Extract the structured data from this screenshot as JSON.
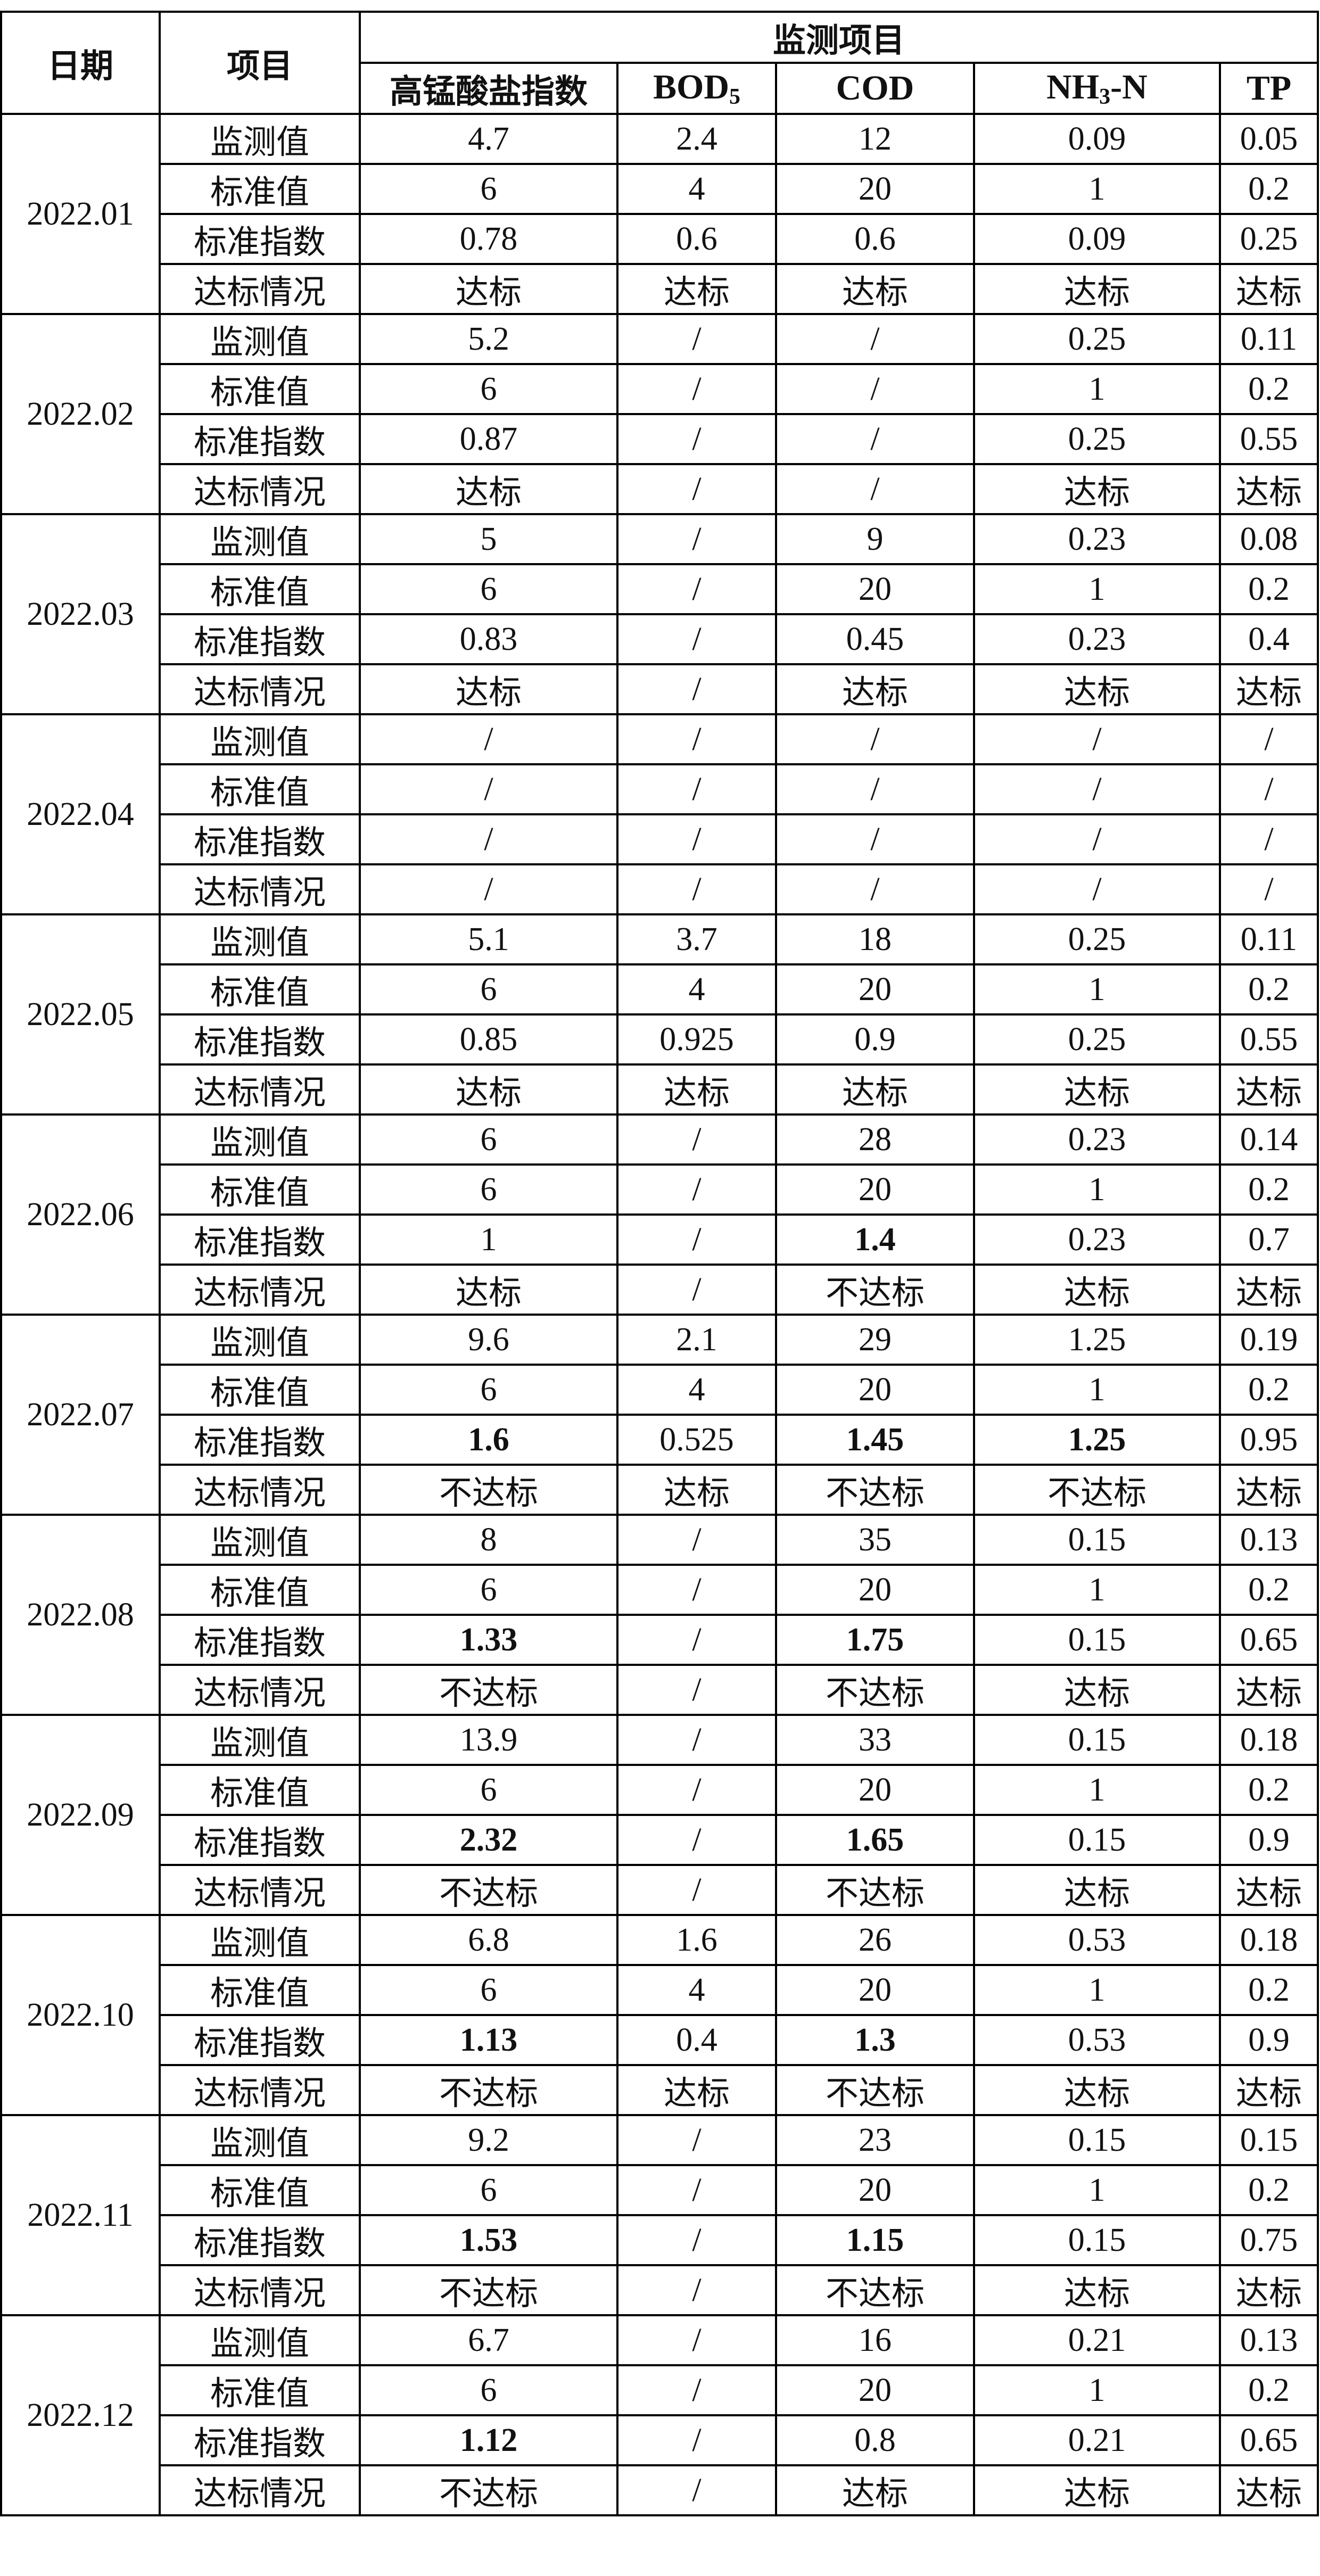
{
  "header": {
    "date": "日期",
    "item": "项目",
    "group": "监测项目",
    "p1": "高锰酸盐指数",
    "p2_base": "BOD",
    "p2_sub": "5",
    "p3": "COD",
    "p4_pre": "NH",
    "p4_sub": "3",
    "p4_post": "-N",
    "p5": "TP"
  },
  "months": [
    {
      "date": "2022.01",
      "rows": [
        {
          "label": "监测值",
          "v": [
            "4.7",
            "2.4",
            "12",
            "0.09",
            "0.05"
          ]
        },
        {
          "label": "标准值",
          "v": [
            "6",
            "4",
            "20",
            "1",
            "0.2"
          ]
        },
        {
          "label": "标准指数",
          "v": [
            "0.78",
            "0.6",
            "0.6",
            "0.09",
            "0.25"
          ]
        },
        {
          "label": "达标情况",
          "v": [
            "达标",
            "达标",
            "达标",
            "达标",
            "达标"
          ]
        }
      ]
    },
    {
      "date": "2022.02",
      "rows": [
        {
          "label": "监测值",
          "v": [
            "5.2",
            "/",
            "/",
            "0.25",
            "0.11"
          ]
        },
        {
          "label": "标准值",
          "v": [
            "6",
            "/",
            "/",
            "1",
            "0.2"
          ]
        },
        {
          "label": "标准指数",
          "v": [
            "0.87",
            "/",
            "/",
            "0.25",
            "0.55"
          ]
        },
        {
          "label": "达标情况",
          "v": [
            "达标",
            "/",
            "/",
            "达标",
            "达标"
          ]
        }
      ]
    },
    {
      "date": "2022.03",
      "rows": [
        {
          "label": "监测值",
          "v": [
            "5",
            "/",
            "9",
            "0.23",
            "0.08"
          ]
        },
        {
          "label": "标准值",
          "v": [
            "6",
            "/",
            "20",
            "1",
            "0.2"
          ]
        },
        {
          "label": "标准指数",
          "v": [
            "0.83",
            "/",
            "0.45",
            "0.23",
            "0.4"
          ]
        },
        {
          "label": "达标情况",
          "v": [
            "达标",
            "/",
            "达标",
            "达标",
            "达标"
          ]
        }
      ]
    },
    {
      "date": "2022.04",
      "rows": [
        {
          "label": "监测值",
          "v": [
            "/",
            "/",
            "/",
            "/",
            "/"
          ]
        },
        {
          "label": "标准值",
          "v": [
            "/",
            "/",
            "/",
            "/",
            "/"
          ]
        },
        {
          "label": "标准指数",
          "v": [
            "/",
            "/",
            "/",
            "/",
            "/"
          ]
        },
        {
          "label": "达标情况",
          "v": [
            "/",
            "/",
            "/",
            "/",
            "/"
          ]
        }
      ]
    },
    {
      "date": "2022.05",
      "rows": [
        {
          "label": "监测值",
          "v": [
            "5.1",
            "3.7",
            "18",
            "0.25",
            "0.11"
          ]
        },
        {
          "label": "标准值",
          "v": [
            "6",
            "4",
            "20",
            "1",
            "0.2"
          ]
        },
        {
          "label": "标准指数",
          "v": [
            "0.85",
            "0.925",
            "0.9",
            "0.25",
            "0.55"
          ]
        },
        {
          "label": "达标情况",
          "v": [
            "达标",
            "达标",
            "达标",
            "达标",
            "达标"
          ]
        }
      ]
    },
    {
      "date": "2022.06",
      "rows": [
        {
          "label": "监测值",
          "v": [
            "6",
            "/",
            "28",
            "0.23",
            "0.14"
          ]
        },
        {
          "label": "标准值",
          "v": [
            "6",
            "/",
            "20",
            "1",
            "0.2"
          ]
        },
        {
          "label": "标准指数",
          "v": [
            "1",
            "/",
            "1.4",
            "0.23",
            "0.7"
          ]
        },
        {
          "label": "达标情况",
          "v": [
            "达标",
            "/",
            "不达标",
            "达标",
            "达标"
          ]
        }
      ]
    },
    {
      "date": "2022.07",
      "rows": [
        {
          "label": "监测值",
          "v": [
            "9.6",
            "2.1",
            "29",
            "1.25",
            "0.19"
          ]
        },
        {
          "label": "标准值",
          "v": [
            "6",
            "4",
            "20",
            "1",
            "0.2"
          ]
        },
        {
          "label": "标准指数",
          "v": [
            "1.6",
            "0.525",
            "1.45",
            "1.25",
            "0.95"
          ]
        },
        {
          "label": "达标情况",
          "v": [
            "不达标",
            "达标",
            "不达标",
            "不达标",
            "达标"
          ]
        }
      ]
    },
    {
      "date": "2022.08",
      "rows": [
        {
          "label": "监测值",
          "v": [
            "8",
            "/",
            "35",
            "0.15",
            "0.13"
          ]
        },
        {
          "label": "标准值",
          "v": [
            "6",
            "/",
            "20",
            "1",
            "0.2"
          ]
        },
        {
          "label": "标准指数",
          "v": [
            "1.33",
            "/",
            "1.75",
            "0.15",
            "0.65"
          ]
        },
        {
          "label": "达标情况",
          "v": [
            "不达标",
            "/",
            "不达标",
            "达标",
            "达标"
          ]
        }
      ]
    },
    {
      "date": "2022.09",
      "rows": [
        {
          "label": "监测值",
          "v": [
            "13.9",
            "/",
            "33",
            "0.15",
            "0.18"
          ]
        },
        {
          "label": "标准值",
          "v": [
            "6",
            "/",
            "20",
            "1",
            "0.2"
          ]
        },
        {
          "label": "标准指数",
          "v": [
            "2.32",
            "/",
            "1.65",
            "0.15",
            "0.9"
          ]
        },
        {
          "label": "达标情况",
          "v": [
            "不达标",
            "/",
            "不达标",
            "达标",
            "达标"
          ]
        }
      ]
    },
    {
      "date": "2022.10",
      "rows": [
        {
          "label": "监测值",
          "v": [
            "6.8",
            "1.6",
            "26",
            "0.53",
            "0.18"
          ]
        },
        {
          "label": "标准值",
          "v": [
            "6",
            "4",
            "20",
            "1",
            "0.2"
          ]
        },
        {
          "label": "标准指数",
          "v": [
            "1.13",
            "0.4",
            "1.3",
            "0.53",
            "0.9"
          ]
        },
        {
          "label": "达标情况",
          "v": [
            "不达标",
            "达标",
            "不达标",
            "达标",
            "达标"
          ]
        }
      ]
    },
    {
      "date": "2022.11",
      "rows": [
        {
          "label": "监测值",
          "v": [
            "9.2",
            "/",
            "23",
            "0.15",
            "0.15"
          ]
        },
        {
          "label": "标准值",
          "v": [
            "6",
            "/",
            "20",
            "1",
            "0.2"
          ]
        },
        {
          "label": "标准指数",
          "v": [
            "1.53",
            "/",
            "1.15",
            "0.15",
            "0.75"
          ]
        },
        {
          "label": "达标情况",
          "v": [
            "不达标",
            "/",
            "不达标",
            "达标",
            "达标"
          ]
        }
      ]
    },
    {
      "date": "2022.12",
      "rows": [
        {
          "label": "监测值",
          "v": [
            "6.7",
            "/",
            "16",
            "0.21",
            "0.13"
          ]
        },
        {
          "label": "标准值",
          "v": [
            "6",
            "/",
            "20",
            "1",
            "0.2"
          ]
        },
        {
          "label": "标准指数",
          "v": [
            "1.12",
            "/",
            "0.8",
            "0.21",
            "0.65"
          ]
        },
        {
          "label": "达标情况",
          "v": [
            "不达标",
            "/",
            "达标",
            "达标",
            "达标"
          ]
        }
      ]
    }
  ]
}
